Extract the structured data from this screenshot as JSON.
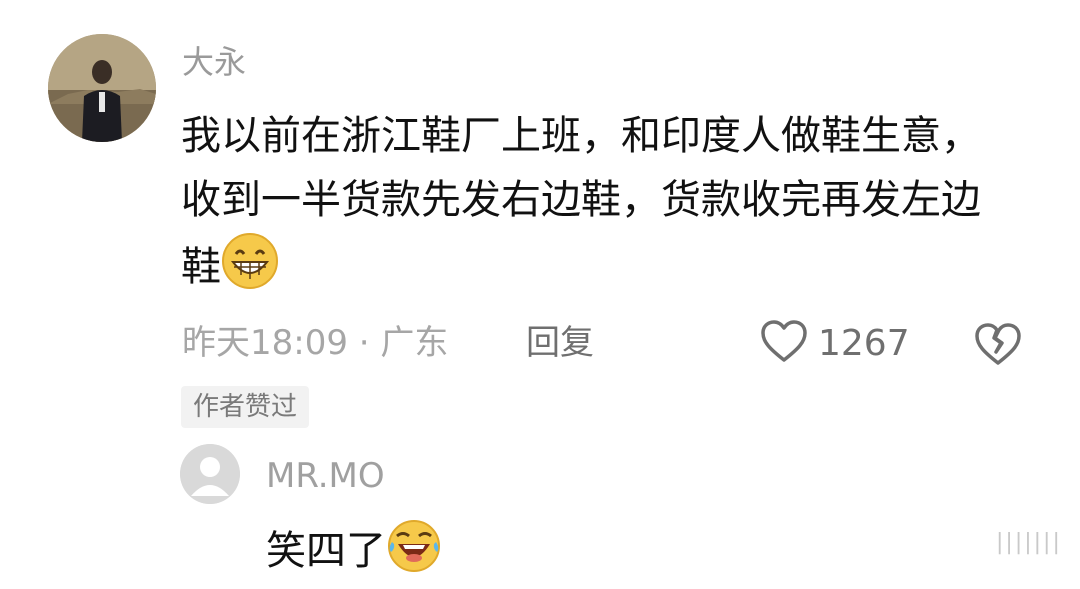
{
  "comment": {
    "username": "大永",
    "content": "我以前在浙江鞋厂上班，和印度人做鞋生意，收到一半货款先发右边鞋，货款收完再发左边鞋",
    "emoji_icon": "grinning-face-icon",
    "time": "昨天18:09",
    "separator": "·",
    "location": "广东",
    "reply_label": "回复",
    "like_count": "1267",
    "author_badge": "作者赞过"
  },
  "reply": {
    "username": "MR.MO",
    "content": "笑四了",
    "emoji_icon": "rolling-laughing-face-icon"
  },
  "watermark": "|||||||"
}
